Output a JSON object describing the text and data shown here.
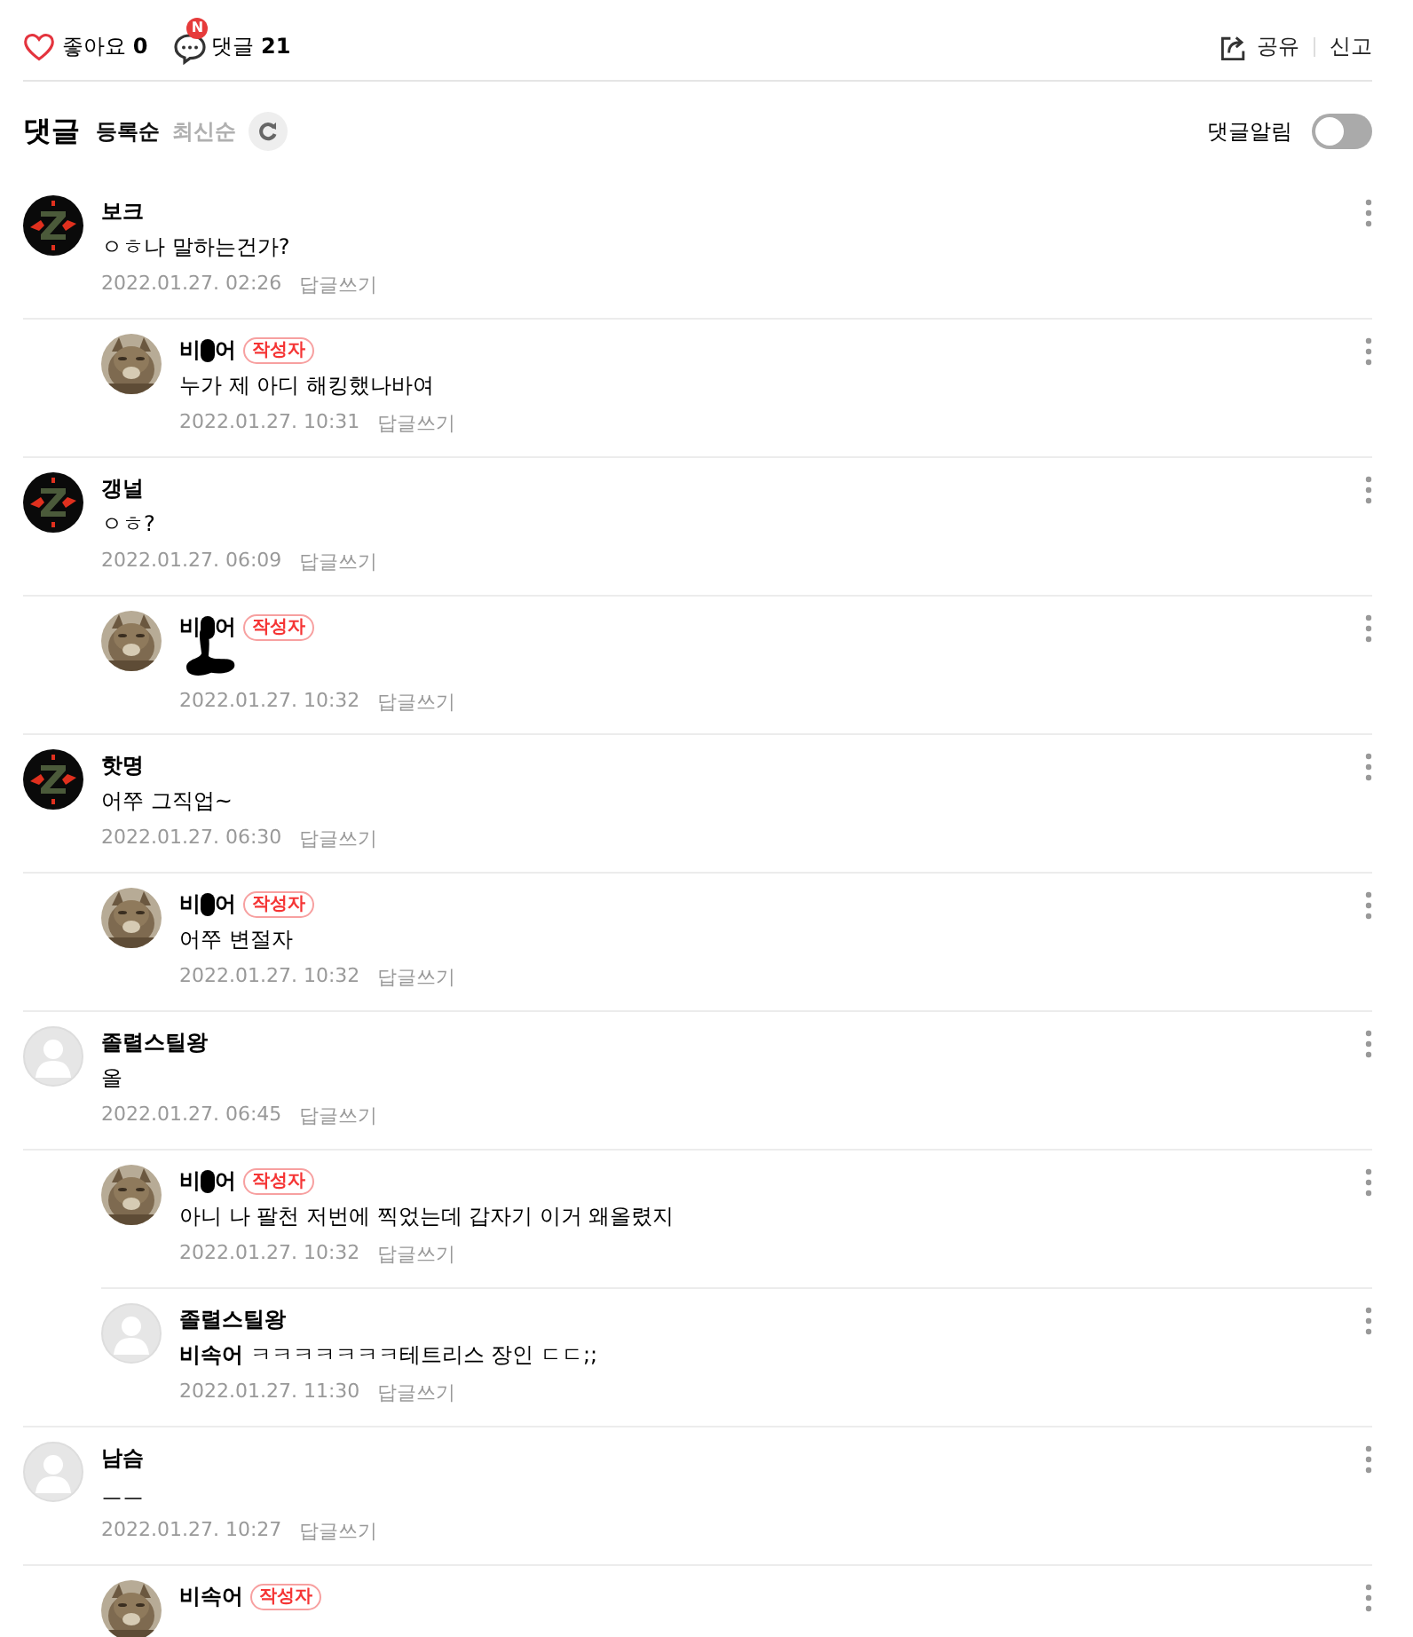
{
  "top_bar": {
    "like_label": "좋아요",
    "like_count": "0",
    "new_badge": "N",
    "comment_label": "댓글",
    "comment_count": "21",
    "share": "공유",
    "report": "신고"
  },
  "header": {
    "title": "댓글",
    "sorts": [
      {
        "label": "등록순",
        "selected": true
      },
      {
        "label": "최신순",
        "selected": false
      }
    ],
    "alarm_label": "댓글알림",
    "alarm_on": false
  },
  "comments": [
    {
      "kind": "comment",
      "avatar": {
        "kind": "z"
      },
      "name": "보크",
      "text": "ㅇㅎ나 말하는건가?",
      "date": "2022.01.27. 02:26",
      "reply": "답글쓰기"
    },
    {
      "kind": "reply",
      "name_start": "비",
      "name_end": "어",
      "censored": true,
      "badge": "작성자",
      "text": "누가 제 아디 해킹했나바여",
      "date": "2022.01.27. 10:31",
      "reply": "답글쓰기"
    },
    {
      "kind": "comment",
      "avatar": {
        "kind": "z"
      },
      "name": "갱널",
      "text": "ㅇㅎ?",
      "date": "2022.01.27. 06:09",
      "reply": "답글쓰기"
    },
    {
      "kind": "reply",
      "name_start": "비",
      "name_end": "어",
      "censored": true,
      "badge": "작성자",
      "text_censored": true,
      "date": "2022.01.27. 10:32",
      "reply": "답글쓰기"
    },
    {
      "kind": "comment",
      "avatar": {
        "kind": "z"
      },
      "name": "핫명",
      "text": "어쭈 그직업~",
      "date": "2022.01.27. 06:30",
      "reply": "답글쓰기"
    },
    {
      "kind": "reply",
      "name_start": "비",
      "name_end": "어",
      "censored": true,
      "badge": "작성자",
      "text": "어쭈 변절자",
      "date": "2022.01.27. 10:32",
      "reply": "답글쓰기"
    },
    {
      "kind": "comment",
      "avatar": {
        "kind": "default"
      },
      "name": "졸렬스틸왕",
      "text": "올",
      "date": "2022.01.27. 06:45",
      "reply": "답글쓰기"
    },
    {
      "kind": "reply",
      "name_start": "비",
      "name_end": "어",
      "censored": true,
      "badge": "작성자",
      "text": "아니 나 팔천 저번에 찍었는데 갑자기 이거 왜올렸지",
      "date": "2022.01.27. 10:32",
      "reply": "답글쓰기"
    },
    {
      "kind": "reply",
      "avatar": {
        "kind": "default"
      },
      "name": "졸렬스틸왕",
      "text": "**비속어** ㅋㅋㅋㅋㅋㅋㅋ테트리스 장인 ㄷㄷ;;",
      "date": "2022.01.27. 11:30",
      "reply": "답글쓰기"
    },
    {
      "kind": "comment",
      "avatar": {
        "kind": "default"
      },
      "name": "남슴",
      "text": "ㅡㅡ",
      "date": "2022.01.27. 10:27",
      "reply": "답글쓰기"
    },
    {
      "kind": "reply",
      "name": "비속어",
      "badge": "작성자"
    }
  ]
}
